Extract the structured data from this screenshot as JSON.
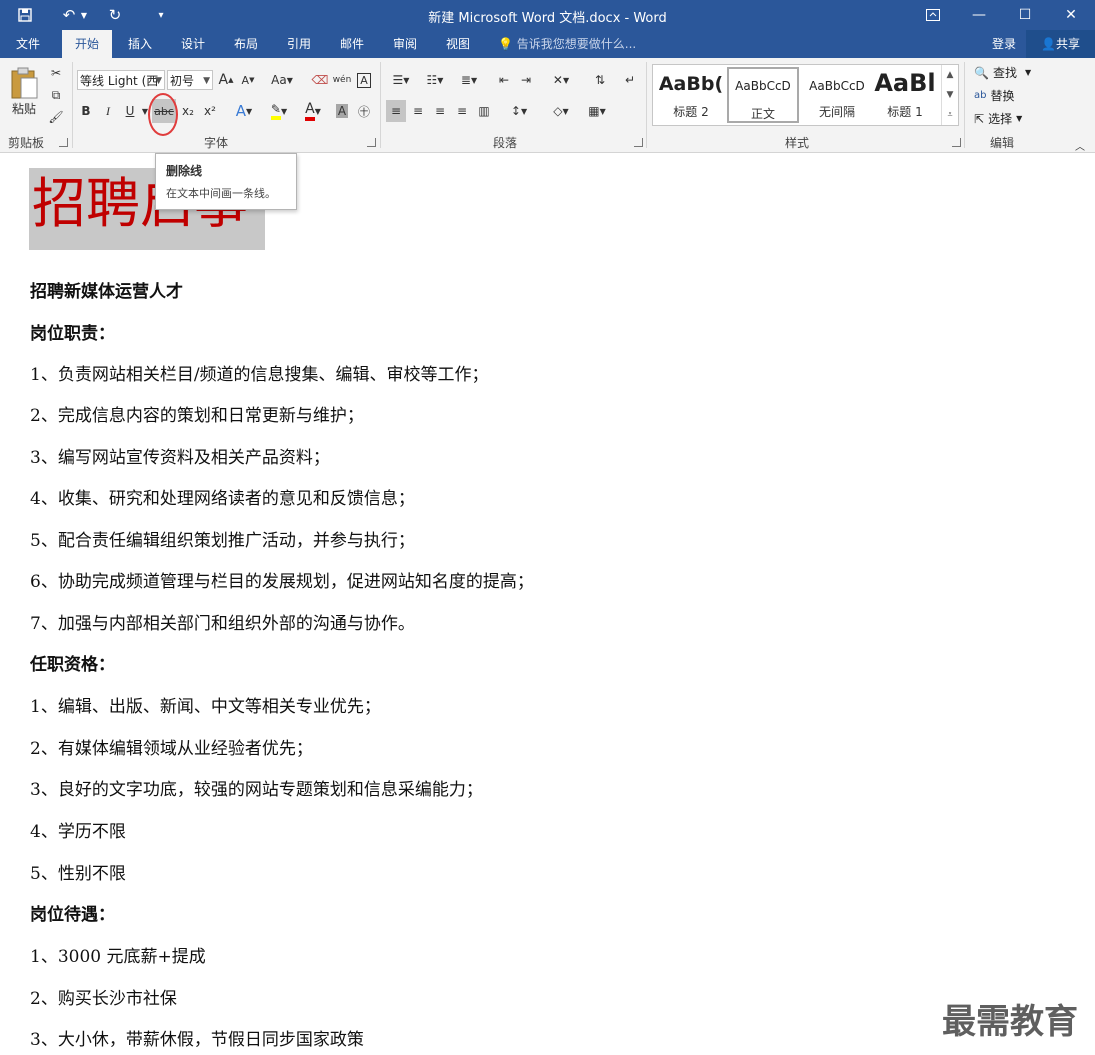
{
  "window": {
    "title": "新建 Microsoft Word 文档.docx - Word"
  },
  "tabs": [
    {
      "label": "文件",
      "active": false
    },
    {
      "label": "开始",
      "active": true
    },
    {
      "label": "插入",
      "active": false
    },
    {
      "label": "设计",
      "active": false
    },
    {
      "label": "布局",
      "active": false
    },
    {
      "label": "引用",
      "active": false
    },
    {
      "label": "邮件",
      "active": false
    },
    {
      "label": "审阅",
      "active": false
    },
    {
      "label": "视图",
      "active": false
    }
  ],
  "tell_me": "告诉我您想要做什么...",
  "account": {
    "login": "登录",
    "share": "共享"
  },
  "ribbon": {
    "clipboard": {
      "paste": "粘贴",
      "label": "剪贴板"
    },
    "font": {
      "font_name": "等线 Light (西",
      "font_size": "初号",
      "bold": "B",
      "italic": "I",
      "underline": "U",
      "strikethrough": "abc",
      "subscript": "x₂",
      "superscript": "x²",
      "grow": "A",
      "shrink": "A",
      "case": "Aa",
      "phonetic": "wén",
      "label": "字体"
    },
    "paragraph": {
      "label": "段落"
    },
    "styles": {
      "label": "样式",
      "items": [
        {
          "sample": "AaBb(",
          "name": "标题 2"
        },
        {
          "sample": "AaBbCcD",
          "name": "正文"
        },
        {
          "sample": "AaBbCcD",
          "name": "无间隔"
        },
        {
          "sample": "AaBl",
          "name": "标题 1"
        }
      ]
    },
    "editing": {
      "find": "查找",
      "replace": "替换",
      "select": "选择",
      "label": "编辑"
    }
  },
  "tooltip": {
    "title": "删除线",
    "description": "在文本中间画一条线。"
  },
  "document": {
    "headline": "招聘启事",
    "lines": [
      {
        "text": "招聘新媒体运营人才",
        "bold": true
      },
      {
        "text": "岗位职责：",
        "bold": true
      },
      {
        "text": "1、负责网站相关栏目/频道的信息搜集、编辑、审校等工作；",
        "bold": false
      },
      {
        "text": "2、完成信息内容的策划和日常更新与维护；",
        "bold": false
      },
      {
        "text": "3、编写网站宣传资料及相关产品资料；",
        "bold": false
      },
      {
        "text": "4、收集、研究和处理网络读者的意见和反馈信息；",
        "bold": false
      },
      {
        "text": "5、配合责任编辑组织策划推广活动，并参与执行；",
        "bold": false
      },
      {
        "text": "6、协助完成频道管理与栏目的发展规划，促进网站知名度的提高；",
        "bold": false
      },
      {
        "text": "7、加强与内部相关部门和组织外部的沟通与协作。",
        "bold": false
      },
      {
        "text": "任职资格：",
        "bold": true
      },
      {
        "text": "1、编辑、出版、新闻、中文等相关专业优先；",
        "bold": false
      },
      {
        "text": "2、有媒体编辑领域从业经验者优先；",
        "bold": false
      },
      {
        "text": "3、良好的文字功底，较强的网站专题策划和信息采编能力；",
        "bold": false
      },
      {
        "text": "4、学历不限",
        "bold": false
      },
      {
        "text": "5、性别不限",
        "bold": false
      },
      {
        "text": "岗位待遇：",
        "bold": true
      },
      {
        "text": "1、3000 元底薪+提成",
        "bold": false
      },
      {
        "text": "2、购买长沙市社保",
        "bold": false
      },
      {
        "text": "3、大小休，带薪休假，节假日同步国家政策",
        "bold": false
      }
    ]
  },
  "watermark": "最需教育",
  "colors": {
    "accent": "#2b579a",
    "headline": "#c00000",
    "highlight_circle": "#e03c3c"
  }
}
